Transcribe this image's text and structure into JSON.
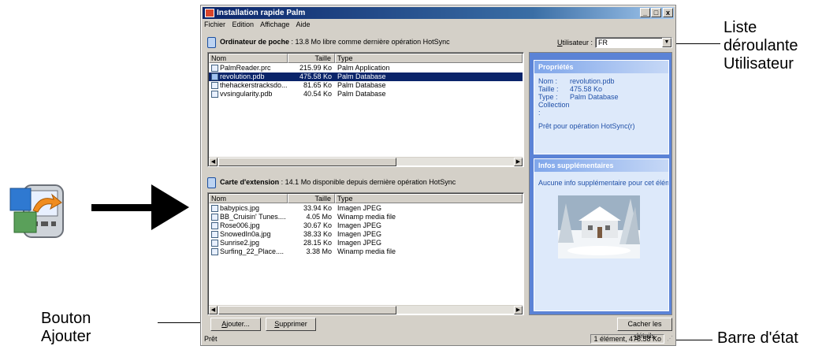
{
  "window": {
    "title": "Installation rapide Palm",
    "controls": [
      "_",
      "□",
      "x"
    ]
  },
  "menu": [
    "Fichier",
    "Edition",
    "Affichage",
    "Aide"
  ],
  "handheld": {
    "label": "Ordinateur de poche",
    "info": " : 13.8 Mo libre comme dernière opération HotSync",
    "columns": [
      "Nom",
      "Taille",
      "Type"
    ],
    "rows": [
      {
        "name": "PalmReader.prc",
        "size": "215.99 Ko",
        "type": "Palm Application",
        "selected": false
      },
      {
        "name": "revolution.pdb",
        "size": "475.58 Ko",
        "type": "Palm Database",
        "selected": true
      },
      {
        "name": "thehackerstracksdo...",
        "size": "81.65 Ko",
        "type": "Palm Database",
        "selected": false
      },
      {
        "name": "vvsingularity.pdb",
        "size": "40.54 Ko",
        "type": "Palm Database",
        "selected": false
      }
    ]
  },
  "card": {
    "label": "Carte d'extension",
    "info": " : 14.1 Mo disponible depuis dernière opération HotSync",
    "columns": [
      "Nom",
      "Taille",
      "Type"
    ],
    "rows": [
      {
        "name": "babypics.jpg",
        "size": "33.94 Ko",
        "type": "Imagen JPEG"
      },
      {
        "name": "BB_Cruisin' Tunes....",
        "size": "4.05 Mo",
        "type": "Winamp media file"
      },
      {
        "name": "Rose006.jpg",
        "size": "30.67 Ko",
        "type": "Imagen JPEG"
      },
      {
        "name": "SnowedIn0a.jpg",
        "size": "38.33 Ko",
        "type": "Imagen JPEG"
      },
      {
        "name": "Sunrise2.jpg",
        "size": "28.15 Ko",
        "type": "Imagen JPEG"
      },
      {
        "name": "Surfing_22_Place....",
        "size": "3.38 Mo",
        "type": "Winamp media file"
      }
    ]
  },
  "user": {
    "label_u": "U",
    "label_rest": "tilisateur :",
    "value": "FR"
  },
  "properties": {
    "title": "Propriétés",
    "lines": [
      {
        "k": "Nom :",
        "v": "revolution.pdb"
      },
      {
        "k": "Taille :",
        "v": "475.58 Ko"
      },
      {
        "k": "Type :",
        "v": "Palm Database"
      },
      {
        "k": "Collection :",
        "v": ""
      }
    ],
    "status": "Prêt pour opération HotSync(r)"
  },
  "extra": {
    "title": "Infos supplémentaires",
    "text": "Aucune info supplémentaire pour cet élémen"
  },
  "buttons": {
    "add_u": "A",
    "add_rest": "jouter...",
    "remove_u": "S",
    "remove_rest": "upprimer",
    "hide_rest": "Cacher les ",
    "hide_u": "d",
    "hide_end": "étails"
  },
  "status": {
    "left": "Prêt",
    "right": "1 élément, 475.58 Ko"
  },
  "callouts": {
    "user_list": [
      "Liste",
      "déroulante",
      "Utilisateur"
    ],
    "add_button": [
      "Bouton",
      "Ajouter"
    ],
    "status_bar": "Barre d'état"
  }
}
